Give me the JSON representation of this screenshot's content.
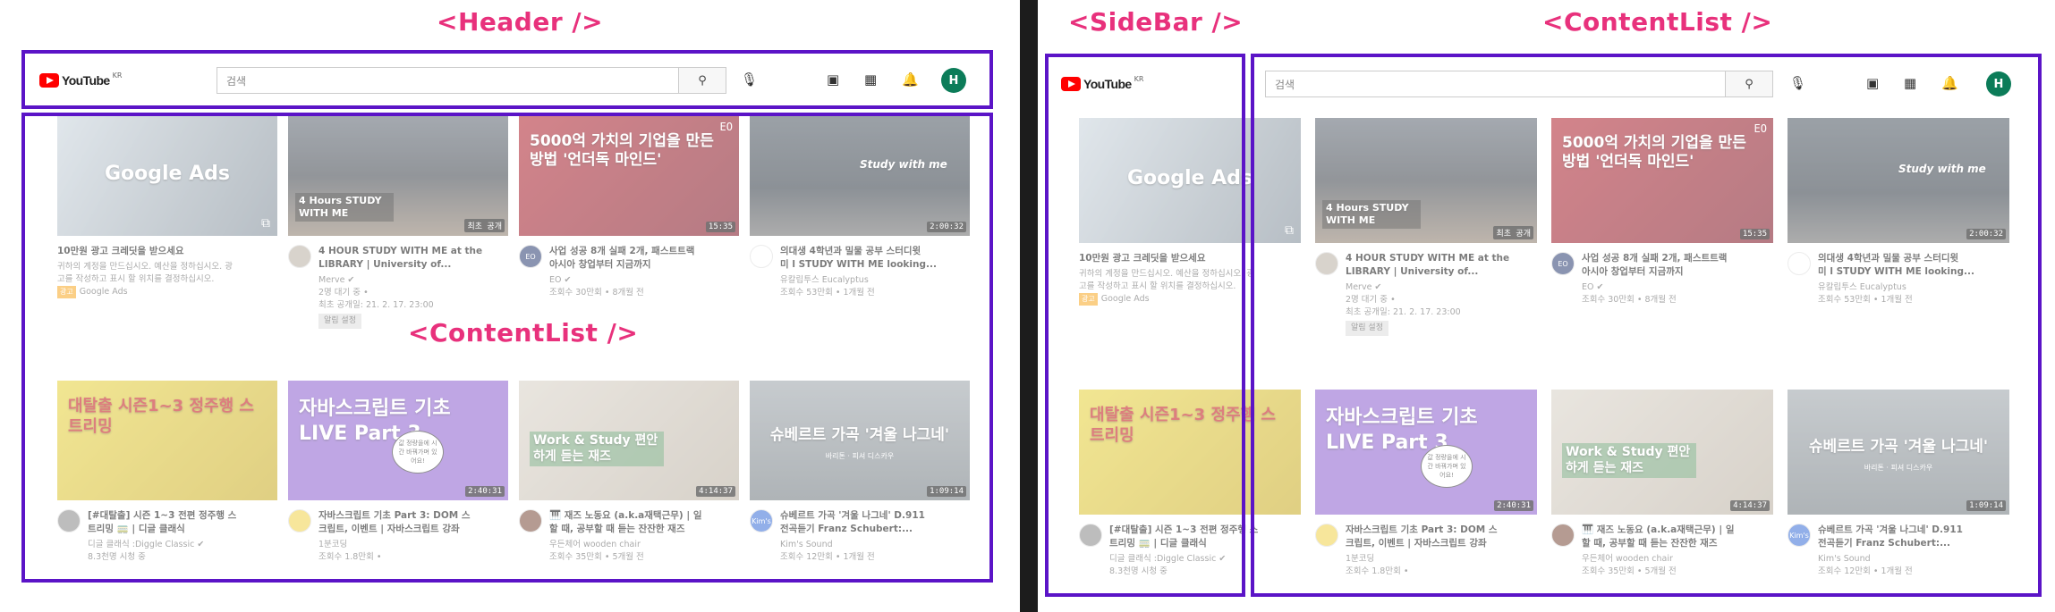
{
  "annotations": {
    "header": "<Header />",
    "sidebar": "<SideBar />",
    "content_list": "<ContentList />"
  },
  "header": {
    "logo_text": "YouTube",
    "logo_region": "KR",
    "search_placeholder": "검색",
    "avatar_initial": "H",
    "icons": [
      "search-icon",
      "mic-icon",
      "video-create-icon",
      "apps-grid-icon",
      "bell-icon"
    ]
  },
  "colors": {
    "annotation_text": "#e8317c",
    "annotation_box": "#5b14c7",
    "avatar": "#0c7c59",
    "logo_red": "#ff0000"
  },
  "videos": [
    {
      "thumb_title": "Google Ads",
      "title1": "10만원 광고 크레딧을 받으세요",
      "title2": "",
      "line1": "귀하의 계정을 만드십시오. 예산을 정하십시오. 광",
      "line2": "고를 작성하고 표시 할 위치를 결정하십시오.",
      "line3": "Google Ads",
      "ad_badge": "광고",
      "duration": "",
      "badge": ""
    },
    {
      "thumb_title": "4 Hours STUDY WITH ME",
      "title1": "4 HOUR STUDY WITH ME at the",
      "title2": "LIBRARY | University of...",
      "line1": "Merve ✔",
      "line2": "2명 대기 중 •",
      "line3": "최초 공개일: 21. 2. 17. 23:00",
      "pill": "알림 설정",
      "duration": "",
      "badge": "최초 공개"
    },
    {
      "thumb_title": "5000억 가치의 기업을 만든 방법 '언더독 마인드'",
      "title1": "사업 성공 8개 실패 2개, 패스트트랙",
      "title2": "아시아 창업부터 지금까지",
      "line1": "EO ✔",
      "line2": "조회수 30만회 • 8개월 전",
      "line3": "",
      "channel_initials": "EO",
      "duration": "15:35",
      "badge": "EO"
    },
    {
      "thumb_title": "Study with me",
      "title1": "의대생 4학년과 밀물 공부 스터디윗",
      "title2": "미 l STUDY WITH ME looking...",
      "line1": "유칼립투스 Eucalyptus",
      "line2": "조회수 53만회 • 1개월 전",
      "line3": "",
      "duration": "2:00:32",
      "badge": ""
    },
    {
      "thumb_title": "대탈출 시즌1~3 정주행 스트리밍",
      "title1": "[#대탈출] 시즌 1~3 전편 정주행 스",
      "title2": "트리밍 🚃 | 디글 클래식",
      "line1": "디글 클래식 :Diggle Classic ✔",
      "line2": "8.3천명 시청 중",
      "line3": "",
      "duration": "",
      "badge": ""
    },
    {
      "thumb_title": "자바스크립트 기초 LIVE Part 3",
      "title1": "자바스크립트 기초 Part 3: DOM 스",
      "title2": "크립트, 이벤트 | 자바스크립트 강좌",
      "line1": "1분코딩",
      "line2": "조회수 1.8만회 •",
      "line3": "",
      "duration": "2:40:31",
      "badge": "",
      "bubble": "값 정량을에 시간 바꿔가며 있어요!"
    },
    {
      "thumb_title": "Work & Study 편안하게 듣는 재즈",
      "title1": "🎹 재즈 노동요 (a.k.a재택근무) | 일",
      "title2": "할 때, 공부할 때 듣는 잔잔한 재즈",
      "line1": "우든체어 wooden chair",
      "line2": "조회수 35만회 • 5개월 전",
      "line3": "",
      "duration": "4:14:37",
      "badge": ""
    },
    {
      "thumb_title": "슈베르트 가곡 '겨울 나그네'",
      "thumb_sub": "바리톤 · 피셔 디스카우",
      "title1": "슈베르트 가곡 '겨울 나그네' D.911",
      "title2": "전곡듣기 Franz Schubert:...",
      "line1": "Kim's Sound",
      "line2": "조회수 12만회 • 1개월 전",
      "line3": "",
      "channel_initials": "Kim's",
      "duration": "1:09:14",
      "badge": ""
    }
  ]
}
